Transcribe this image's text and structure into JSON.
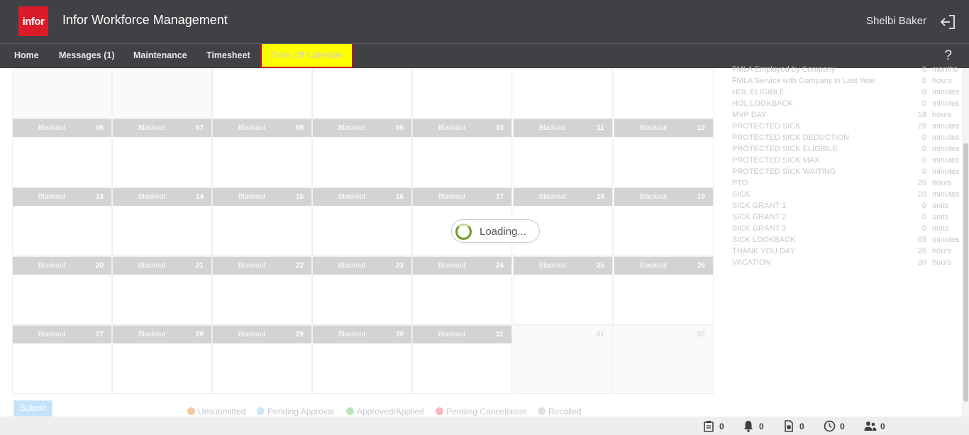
{
  "header": {
    "logo_text": "infor",
    "app_title": "Infor Workforce Management",
    "user_name": "Shelbi Baker",
    "logout_icon": "logout-icon"
  },
  "nav": {
    "items": [
      {
        "label": "Home"
      },
      {
        "label": "Messages (1)"
      },
      {
        "label": "Maintenance"
      },
      {
        "label": "Timesheet"
      },
      {
        "label": "Time Off Calendar",
        "active": true
      }
    ],
    "help_label": "?"
  },
  "calendar": {
    "cell_label": "Blackout",
    "weeks": [
      [
        {
          "day": "06",
          "label": "Blackout"
        },
        {
          "day": "07",
          "label": "Blackout"
        },
        {
          "day": "08",
          "label": "Blackout"
        },
        {
          "day": "09",
          "label": "Blackout"
        },
        {
          "day": "10",
          "label": "Blackout"
        },
        {
          "day": "11",
          "label": "Blackout"
        },
        {
          "day": "12",
          "label": "Blackout"
        }
      ],
      [
        {
          "day": "13",
          "label": "Blackout"
        },
        {
          "day": "14",
          "label": "Blackout"
        },
        {
          "day": "15",
          "label": "Blackout"
        },
        {
          "day": "16",
          "label": "Blackout"
        },
        {
          "day": "17",
          "label": "Blackout"
        },
        {
          "day": "18",
          "label": "Blackout"
        },
        {
          "day": "19",
          "label": "Blackout"
        }
      ],
      [
        {
          "day": "20",
          "label": "Blackout"
        },
        {
          "day": "21",
          "label": "Blackout"
        },
        {
          "day": "22",
          "label": "Blackout"
        },
        {
          "day": "23",
          "label": "Blackout"
        },
        {
          "day": "24",
          "label": "Blackout"
        },
        {
          "day": "25",
          "label": "Blackout"
        },
        {
          "day": "26",
          "label": "Blackout"
        }
      ],
      [
        {
          "day": "27",
          "label": "Blackout"
        },
        {
          "day": "28",
          "label": "Blackout"
        },
        {
          "day": "29",
          "label": "Blackout"
        },
        {
          "day": "30",
          "label": "Blackout"
        },
        {
          "day": "31",
          "label": "Blackout"
        },
        {
          "day": "01",
          "label": "",
          "outside": true
        },
        {
          "day": "02",
          "label": "",
          "outside": true
        }
      ]
    ]
  },
  "loading": {
    "text": "Loading..."
  },
  "balances": [
    {
      "name": "FMLA Employed by Company",
      "value": "0",
      "unit": "months"
    },
    {
      "name": "FMLA Service with Company in Last Year",
      "value": "0",
      "unit": "hours"
    },
    {
      "name": "HOL ELIGIBLE",
      "value": "0",
      "unit": "minutes"
    },
    {
      "name": "HOL LOOKBACK",
      "value": "0",
      "unit": "minutes"
    },
    {
      "name": "MVP DAY",
      "value": "18",
      "unit": "hours"
    },
    {
      "name": "PROTECTED SICK",
      "value": "28",
      "unit": "minutes"
    },
    {
      "name": "PROTECTED SICK DEDUCTION",
      "value": "0",
      "unit": "minutes"
    },
    {
      "name": "PROTECTED SICK ELIGIBLE",
      "value": "0",
      "unit": "minutes"
    },
    {
      "name": "PROTECTED SICK MAX",
      "value": "0",
      "unit": "minutes"
    },
    {
      "name": "PROTECTED SICK WAITING",
      "value": "0",
      "unit": "minutes"
    },
    {
      "name": "PTO",
      "value": "20",
      "unit": "hours"
    },
    {
      "name": "SICK",
      "value": "20",
      "unit": "minutes"
    },
    {
      "name": "SICK GRANT 1",
      "value": "0",
      "unit": "units"
    },
    {
      "name": "SICK GRANT 2",
      "value": "0",
      "unit": "units"
    },
    {
      "name": "SICK GRANT 3",
      "value": "0",
      "unit": "units"
    },
    {
      "name": "SICK LOOKBACK",
      "value": "65",
      "unit": "minutes"
    },
    {
      "name": "THANK YOU DAY",
      "value": "20",
      "unit": "hours"
    },
    {
      "name": "VACATION",
      "value": "30",
      "unit": "hours"
    }
  ],
  "submit_label": "Submit",
  "legend": [
    {
      "label": "Unsubmitted",
      "color": "#f5c8a0",
      "icon": "unsubmitted-icon"
    },
    {
      "label": "Pending Approval",
      "color": "#cde8fa",
      "icon": "pending-approval-icon"
    },
    {
      "label": "Approved/Applied",
      "color": "#b8e6b8",
      "icon": "approved-icon"
    },
    {
      "label": "Pending Cancellation",
      "color": "#f8b8bc",
      "icon": "pending-cancellation-icon"
    },
    {
      "label": "Recalled",
      "color": "#e0e0e0",
      "icon": "recalled-icon"
    }
  ],
  "footer": [
    {
      "icon": "clipboard-icon",
      "count": "0"
    },
    {
      "icon": "bell-icon",
      "count": "0"
    },
    {
      "icon": "document-clock-icon",
      "count": "0"
    },
    {
      "icon": "clock-icon",
      "count": "0"
    },
    {
      "icon": "people-icon",
      "count": "0"
    }
  ],
  "colors": {
    "header_bg": "#404145",
    "brand_red": "#da1c2a",
    "active_tab_bg": "#ffff00",
    "cell_header_bg": "#d3d3d3"
  }
}
